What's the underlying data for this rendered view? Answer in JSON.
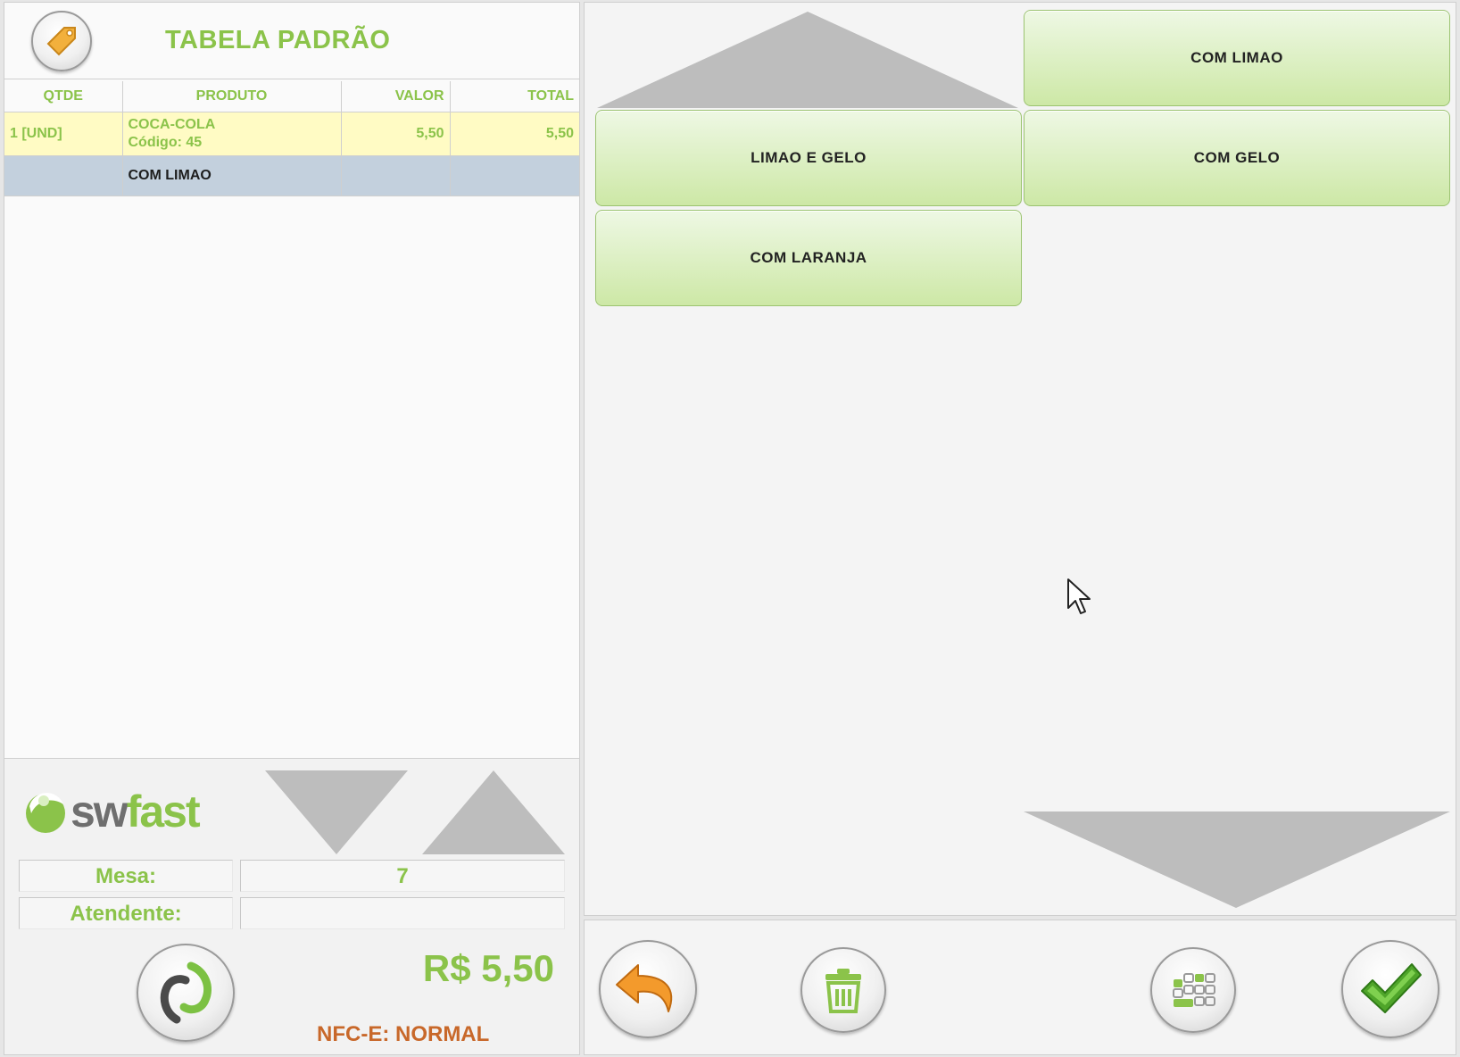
{
  "header": {
    "title": "TABELA PADRÃO",
    "tag_icon": "price-tag-icon"
  },
  "table": {
    "columns": [
      "QTDE",
      "PRODUTO",
      "VALOR",
      "TOTAL"
    ],
    "item": {
      "qty": "1 [UND]",
      "product": "COCA-COLA",
      "code": "Código: 45",
      "value": "5,50",
      "total": "5,50"
    },
    "note": {
      "label": "COM LIMAO"
    }
  },
  "brand": {
    "sw": "sw",
    "fast": "fast"
  },
  "info": {
    "mesa_label": "Mesa:",
    "mesa_value": "7",
    "atendente_label": "Atendente:",
    "atendente_value": ""
  },
  "summary": {
    "total": "R$ 5,50",
    "nfce": "NFC-E: NORMAL"
  },
  "options": [
    "COM LIMAO",
    "LIMAO E GELO",
    "COM GELO",
    "COM LARANJA"
  ],
  "colors": {
    "accent": "#8bc34a",
    "nfce": "#c8682a",
    "button_green": "#cde8a6",
    "note_row": "#c3d0dd",
    "item_row": "#fffbc4"
  },
  "toolbar_icons": [
    "undo-arrow-icon",
    "trash-icon",
    "keyboard-icon",
    "checkmark-icon"
  ]
}
